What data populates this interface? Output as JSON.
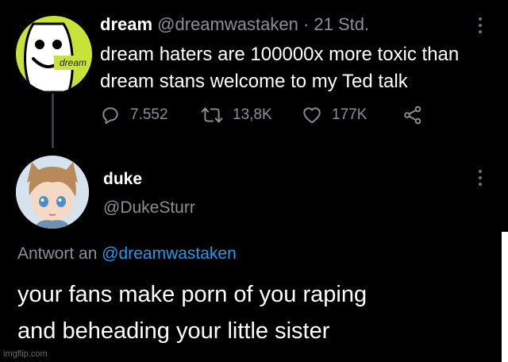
{
  "tweet": {
    "avatar_text": "dream",
    "display_name": "dream",
    "handle": "@dreamwastaken",
    "separator": "·",
    "time": "21 Std.",
    "text_lines": [
      "dream haters are 100000x more toxic than",
      "dream stans welcome to my Ted talk"
    ],
    "replies": "7.552",
    "retweets": "13,8K",
    "likes": "177K",
    "icons": [
      "reply-icon",
      "retweet-icon",
      "like-icon",
      "share-icon",
      "more-icon"
    ]
  },
  "reply": {
    "display_name": "duke",
    "handle": "@DukeSturr",
    "replying_to_prefix": "Antwort an",
    "replying_to_handle": "@dreamwastaken",
    "text_lines": [
      "your fans make porn of you raping",
      "and beheading your little sister"
    ]
  },
  "watermark": "imgflip.com",
  "colors": {
    "background": "#000000",
    "text_primary": "#ffffff",
    "text_secondary": "#8b8f94",
    "link": "#1d9bf0",
    "dream_avatar": "#c8e23a"
  }
}
